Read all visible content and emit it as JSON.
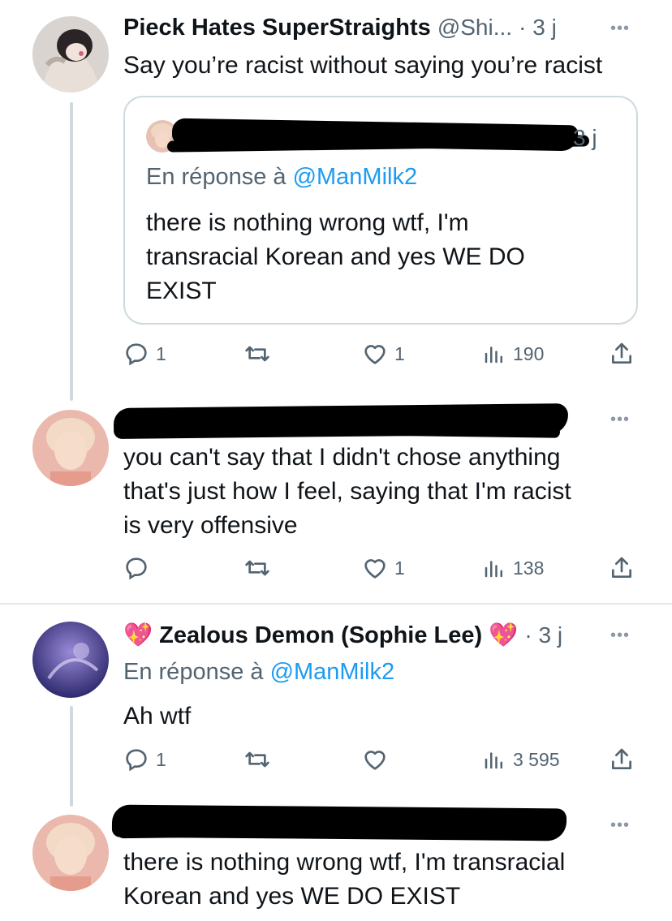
{
  "tweet1": {
    "name": "Pieck Hates SuperStraights",
    "handle": "@Shi...",
    "time": "· 3 j",
    "text": "Say you’re racist without saying you’re racist",
    "quote": {
      "time": "3 j",
      "reply_prefix": "En réponse à",
      "reply_handle": "@ManMilk2",
      "text_lines": [
        "there is nothing wrong wtf, I'm",
        "transracial Korean and yes WE DO",
        "EXIST"
      ]
    },
    "actions": {
      "replies": "1",
      "likes": "1",
      "views": "190"
    }
  },
  "tweet2": {
    "text_lines": [
      "you can't say that I didn't chose anything",
      "that's just how I feel, saying that I'm racist",
      "is very offensive"
    ],
    "actions": {
      "replies": "",
      "likes": "1",
      "views": "138"
    }
  },
  "tweet3": {
    "name": "Zealous Demon (Sophie Lee)",
    "time": "· 3 j",
    "reply_prefix": "En réponse à",
    "reply_handle": "@ManMilk2",
    "text": "Ah wtf",
    "actions": {
      "replies": "1",
      "likes": "",
      "views": "3 595"
    }
  },
  "tweet4": {
    "text_lines": [
      "there is nothing wrong wtf, I'm transracial",
      "Korean and yes WE DO EXIST"
    ]
  },
  "icons": {
    "reply": "speech-bubble-icon",
    "retweet": "retweet-arrows-icon",
    "like": "heart-icon",
    "views": "bar-chart-icon",
    "share": "share-upload-icon",
    "more": "more-dots-icon",
    "heart_emoji": "sparkling-heart-emoji"
  },
  "colors": {
    "link": "#1d9bf0",
    "muted": "#536471",
    "line": "#cfd9de",
    "emoji": "#e0308a"
  }
}
